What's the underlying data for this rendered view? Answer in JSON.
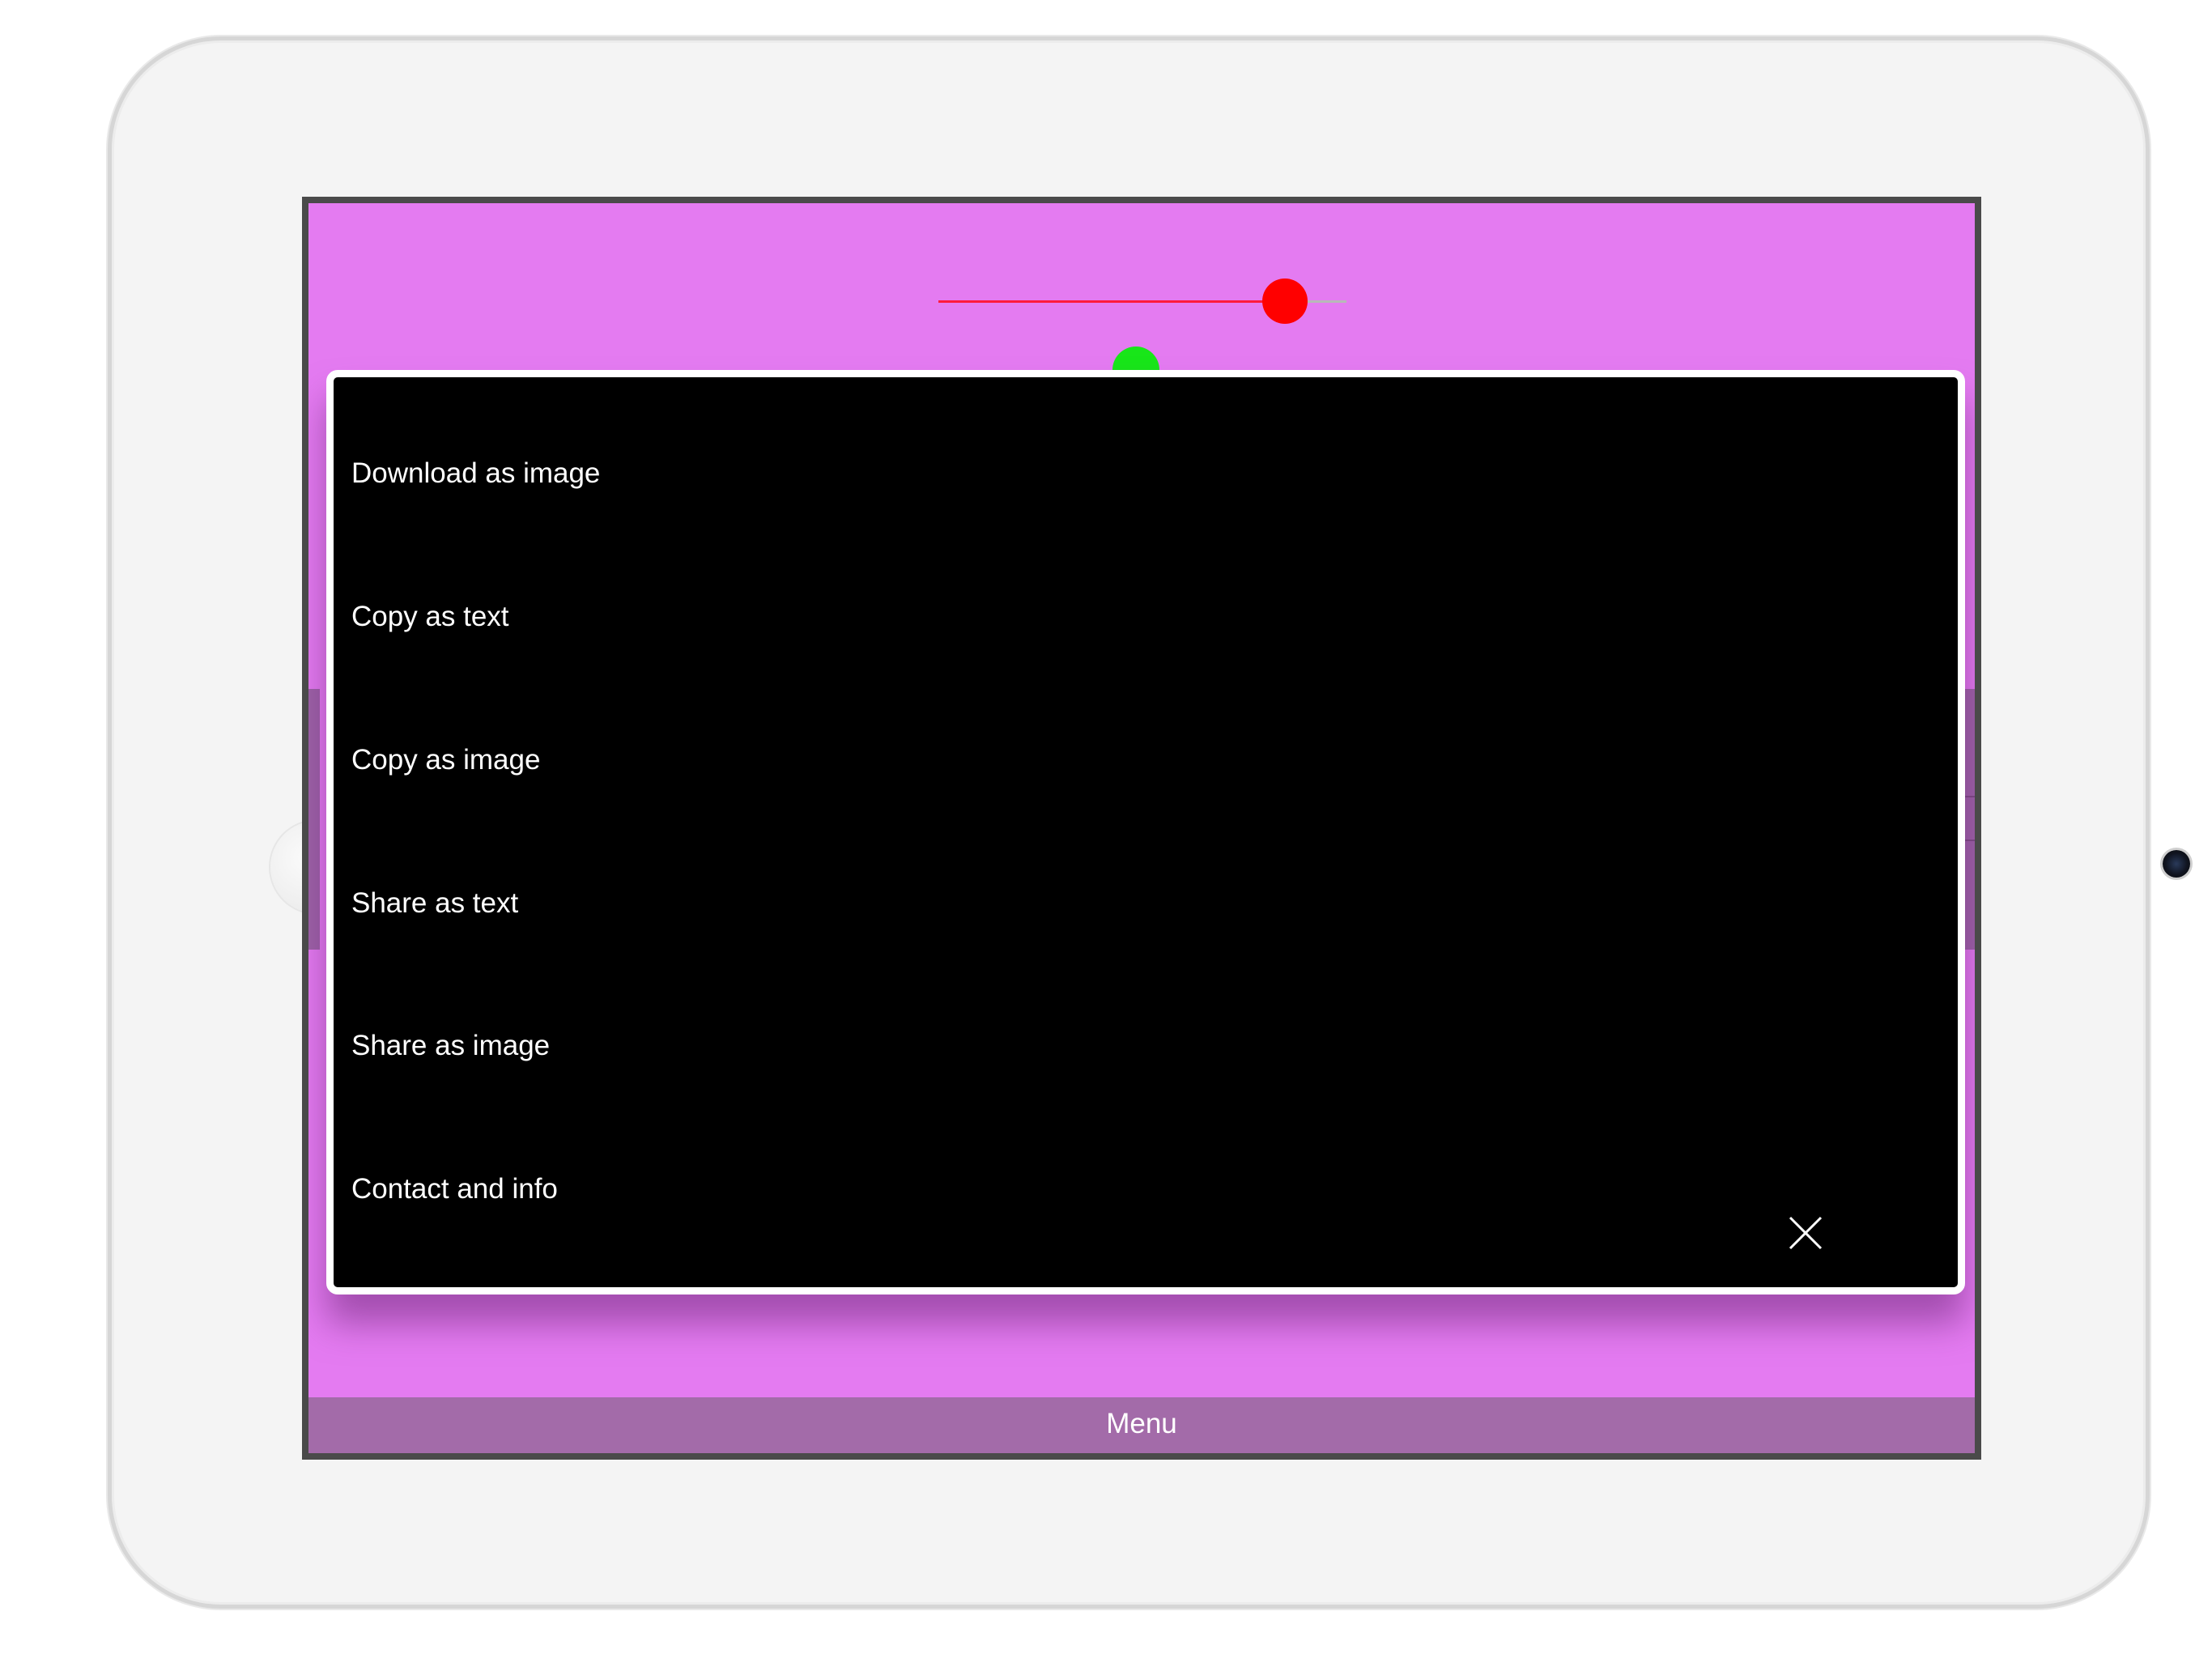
{
  "menu": {
    "items": [
      {
        "label": "Download as image"
      },
      {
        "label": "Copy as text"
      },
      {
        "label": "Copy as image"
      },
      {
        "label": "Share as text"
      },
      {
        "label": "Share as image"
      },
      {
        "label": "Contact and info"
      }
    ],
    "close_icon": "close-icon"
  },
  "slider": {
    "value_fraction": 0.85,
    "thumb_color": "#ff0000",
    "filled_color": "#ff1a3c",
    "empty_color": "#b8b8b8"
  },
  "indicator": {
    "color": "#18e619"
  },
  "bottom_bar": {
    "label": "Menu"
  },
  "colors": {
    "background": "#e47bf1",
    "panel": "#000000",
    "panel_border": "#ffffff",
    "bar": "#a36ba9"
  }
}
